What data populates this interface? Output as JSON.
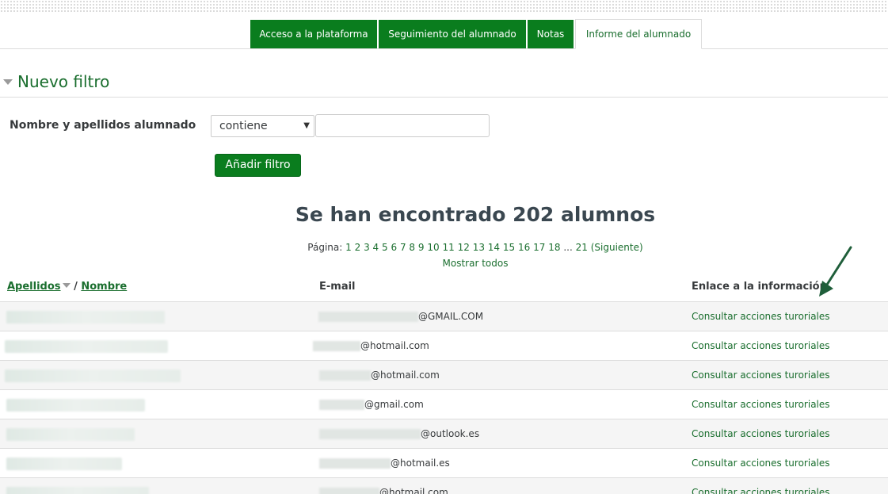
{
  "tabs": [
    {
      "label": "Acceso a la plataforma"
    },
    {
      "label": "Seguimiento del alumnado"
    },
    {
      "label": "Notas"
    },
    {
      "label": "Informe del alumnado"
    }
  ],
  "filter": {
    "title": "Nuevo filtro",
    "field_label": "Nombre y apellidos alumnado",
    "operator_selected": "contiene",
    "value": "",
    "add_button": "Añadir filtro"
  },
  "results": {
    "title": "Se han encontrado 202 alumnos",
    "paging_prefix": "Página:",
    "pages": [
      "1",
      "2",
      "3",
      "4",
      "5",
      "6",
      "7",
      "8",
      "9",
      "10",
      "11",
      "12",
      "13",
      "14",
      "15",
      "16",
      "17",
      "18"
    ],
    "ellipsis": "...",
    "last_page": "21",
    "next_label": "(Siguiente)",
    "show_all": "Mostrar todos"
  },
  "table": {
    "headers": {
      "surname": "Apellidos",
      "separator": "/",
      "name": "Nombre",
      "email": "E-mail",
      "link": "Enlace a la información"
    },
    "rows": [
      {
        "email_visible": "@GMAIL.COM",
        "link": "Consultar acciones turoriales"
      },
      {
        "email_visible": "@hotmail.com",
        "link": "Consultar acciones turoriales"
      },
      {
        "email_visible": "@hotmail.com",
        "link": "Consultar acciones turoriales"
      },
      {
        "email_visible": "@gmail.com",
        "link": "Consultar acciones turoriales"
      },
      {
        "email_visible": "@outlook.es",
        "link": "Consultar acciones turoriales"
      },
      {
        "email_visible": "@hotmail.es",
        "link": "Consultar acciones turoriales"
      },
      {
        "email_visible": "@hotmail.com",
        "link": "Consultar acciones turoriales"
      }
    ]
  },
  "colors": {
    "accent_green": "#0a7d1e",
    "link_green": "#1a6e2e",
    "annotation_arrow": "#1f5e3a"
  }
}
